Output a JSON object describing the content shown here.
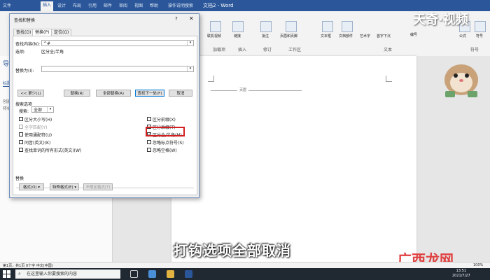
{
  "word": {
    "title": "文档2 - Word",
    "tabs": [
      "文件",
      "插入",
      "设计",
      "布局",
      "引用",
      "邮件",
      "审阅",
      "视图",
      "帮助"
    ],
    "tell_me": "操作说明搜索",
    "ribbon_groups": [
      "加载项",
      "插入",
      "修订",
      "工作区",
      "文本",
      "符号"
    ],
    "ribbon_items": [
      "联机视频",
      "链接",
      "批注",
      "页眉和页脚",
      "文本框",
      "文档部件",
      "艺术字",
      "首字下沉",
      "公式",
      "符号",
      "编号"
    ],
    "header_label": "页眉",
    "nav_pane": {
      "title": "导航",
      "items": [
        "标题",
        "页面",
        "结果"
      ],
      "hint_lines": [
        "创建交互式大纲",
        "将标题样式应用到"
      ]
    },
    "status_left": "第1页，共1页  0个字  中文(中国)",
    "zoom": "100%"
  },
  "dialog": {
    "title": "查找和替换",
    "help": "?",
    "close": "✕",
    "tabs": [
      "查找(D)",
      "替换(P)",
      "定位(G)"
    ],
    "selected_tab": 1,
    "find_label": "查找内容(N):",
    "find_value": "^#",
    "options_label": "选项:",
    "options_value": "区分全/半角",
    "replace_label": "替换为(I):",
    "replace_value": "",
    "buttons": {
      "less": "<< 更少(L)",
      "replace": "替换(R)",
      "replace_all": "全部替换(A)",
      "find_next": "查找下一处(F)",
      "cancel": "取消"
    },
    "search_options_title": "搜索选项",
    "search_label": "搜索:",
    "search_value": "全部",
    "left_options": [
      {
        "label": "区分大小写(H)",
        "checked": false,
        "disabled": false
      },
      {
        "label": "全字匹配(Y)",
        "checked": false,
        "disabled": true
      },
      {
        "label": "使用通配符(U)",
        "checked": false,
        "disabled": false
      },
      {
        "label": "同音(英文)(K)",
        "checked": false,
        "disabled": false
      },
      {
        "label": "查找单词的所有形式(英文)(W)",
        "checked": false,
        "disabled": false
      }
    ],
    "right_options": [
      {
        "label": "区分前缀(X)",
        "checked": false
      },
      {
        "label": "区分后缀(T)",
        "checked": false
      },
      {
        "label": "区分全/半角(M)",
        "checked": true
      },
      {
        "label": "忽略标点符号(S)",
        "checked": false
      },
      {
        "label": "忽略空格(W)",
        "checked": false
      }
    ],
    "replace_section_title": "替换",
    "bottom_buttons": {
      "format": "格式(O) ▾",
      "special": "特殊格式(E) ▾",
      "no_format": "不限定格式(T)"
    }
  },
  "overlay": {
    "subtitle": "打钩选项全部取消",
    "watermark_top": "天奇·视频",
    "watermark_br": "广西龙网"
  },
  "taskbar": {
    "search_placeholder": "在这里输入你要搜索的内容",
    "time": "13:51",
    "date": "2021/7/27"
  },
  "colors": {
    "word_blue": "#2b579a",
    "highlight_red": "#d42020",
    "taskbar": "#202832"
  }
}
